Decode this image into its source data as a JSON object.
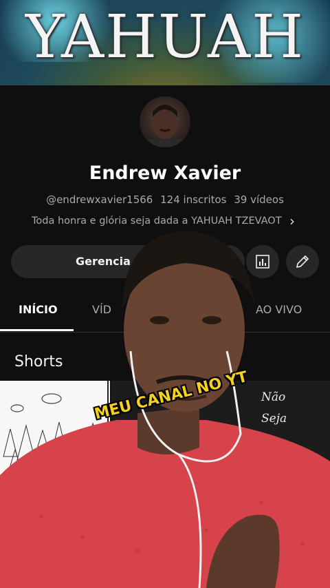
{
  "banner": {
    "title": "YAHUAH"
  },
  "channel": {
    "name": "Endrew Xavier",
    "handle": "@endrewxavier1566",
    "subscribers": "124 inscritos",
    "videos": "39 vídeos",
    "description": "Toda honra e glória seja dada a YAHUAH TZEVAOT"
  },
  "actions": {
    "manage_label": "Gerencia"
  },
  "tabs": [
    {
      "label": "INÍCIO",
      "active": true
    },
    {
      "label": "VÍD"
    },
    {
      "label": "AO VIVO"
    }
  ],
  "sections": {
    "shorts_title": "Shorts"
  },
  "shorts": {
    "right_text_1": "Não",
    "right_text_2": "Seja"
  },
  "overlay": {
    "caption": "MEU CANAL NO YT"
  },
  "icons": {
    "description_more": "chevron-right-icon",
    "stats": "bar-chart-icon",
    "edit": "pencil-icon"
  }
}
